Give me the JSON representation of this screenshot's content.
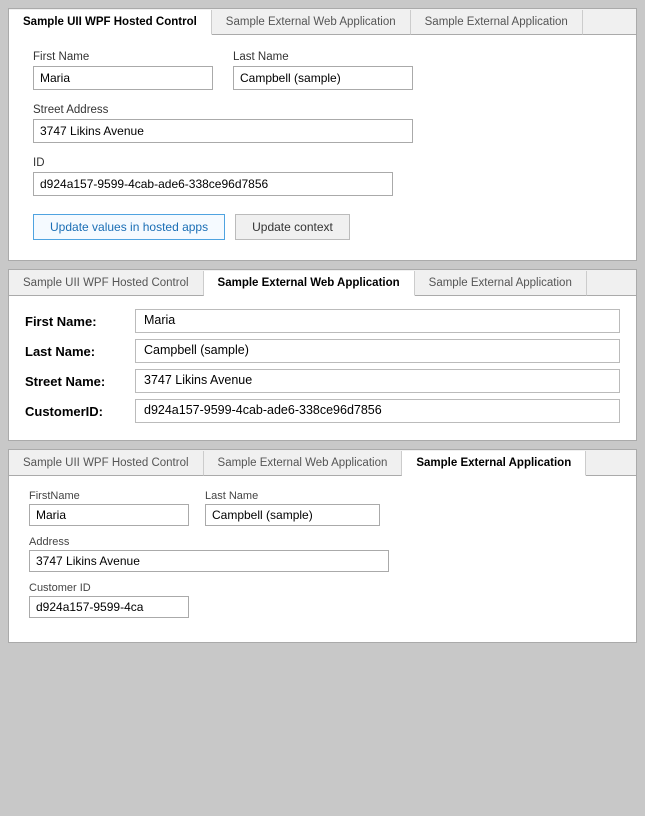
{
  "panel1": {
    "tabs": [
      {
        "label": "Sample UII WPF Hosted Control",
        "active": true
      },
      {
        "label": "Sample External Web Application",
        "active": false
      },
      {
        "label": "Sample External Application",
        "active": false
      }
    ],
    "fields": {
      "first_name_label": "First Name",
      "first_name_value": "Maria",
      "last_name_label": "Last Name",
      "last_name_value": "Campbell (sample)",
      "street_address_label": "Street Address",
      "street_address_value": "3747 Likins Avenue",
      "id_label": "ID",
      "id_value": "d924a157-9599-4cab-ade6-338ce96d7856"
    },
    "buttons": {
      "update_hosted": "Update values in hosted apps",
      "update_context": "Update context"
    }
  },
  "panel2": {
    "tabs": [
      {
        "label": "Sample UII WPF Hosted Control",
        "active": false
      },
      {
        "label": "Sample External Web Application",
        "active": true
      },
      {
        "label": "Sample External Application",
        "active": false
      }
    ],
    "rows": [
      {
        "label": "First Name:",
        "value": "Maria"
      },
      {
        "label": "Last Name:",
        "value": "Campbell (sample)"
      },
      {
        "label": "Street Name:",
        "value": "3747 Likins Avenue"
      },
      {
        "label": "CustomerID:",
        "value": "d924a157-9599-4cab-ade6-338ce96d7856"
      }
    ]
  },
  "panel3": {
    "tabs": [
      {
        "label": "Sample UII WPF Hosted Control",
        "active": false
      },
      {
        "label": "Sample External Web Application",
        "active": false
      },
      {
        "label": "Sample External Application",
        "active": true
      }
    ],
    "fields": {
      "first_name_label": "FirstName",
      "first_name_value": "Maria",
      "last_name_label": "Last Name",
      "last_name_value": "Campbell (sample)",
      "address_label": "Address",
      "address_value": "3747 Likins Avenue",
      "customer_id_label": "Customer ID",
      "customer_id_value": "d924a157-9599-4ca"
    }
  }
}
